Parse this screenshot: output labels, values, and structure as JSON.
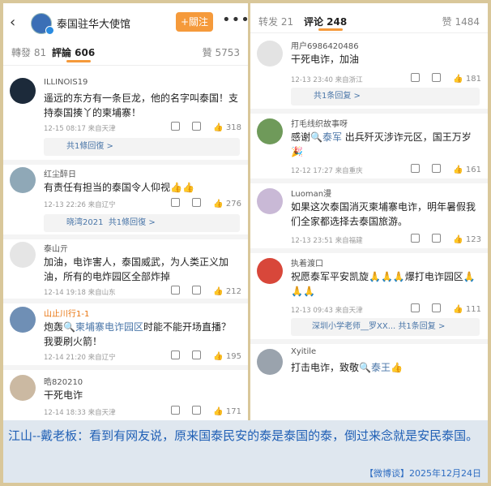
{
  "left": {
    "header": {
      "title": "泰国驻华大使馆",
      "follow": "+關注",
      "more": "•••",
      "back": "‹"
    },
    "tabs": {
      "repost": "轉發 81",
      "comment": "評論 606",
      "like": "贊 5753"
    },
    "comments": [
      {
        "name": "ILLINOIS19",
        "text": "遥远的东方有一条巨龙，他的名字叫泰国！支持泰国揍丫的柬埔寨！",
        "time": "12-15 08:17 来自天津",
        "likes": "318",
        "reply": "共1條回復 >"
      },
      {
        "name": "红尘醉日",
        "text": "有责任有担当的泰国令人仰视👍👍",
        "time": "12-13 22:26 来自辽宁",
        "likes": "276",
        "reply_user": "晓湾2021",
        "reply": "共1條回復 >"
      },
      {
        "name": "泰山亓",
        "text": "加油，电诈害人，泰国威武，为人类正义加油，所有的电炸园区全部炸掉",
        "time": "12-14 19:18 来自山东",
        "likes": "212"
      },
      {
        "name": "山止川行1-1",
        "text_pre": "炮轰",
        "text_link": "柬埔寨电诈园区",
        "text_post": "时能不能开场直播？我要刷火箭！",
        "time": "12-14 21:20 来自辽宁",
        "likes": "195"
      },
      {
        "name": "晧820210",
        "text": "干死电诈",
        "time": "12-14 18:33 来自天津",
        "likes": "171"
      }
    ]
  },
  "right": {
    "tabs": {
      "repost": "转发 21",
      "comment": "评论 248",
      "like": "赞 1484"
    },
    "comments": [
      {
        "name": "用户6986420486",
        "text": "干死电诈，加油",
        "time": "12-13 23:40 来自浙江",
        "likes": "181",
        "reply": "共1条回复 >"
      },
      {
        "name": "打毛线织故事呀",
        "text_pre": "感谢",
        "text_link": "泰军",
        "text_post": " 出兵歼灭涉诈元区，国王万岁🎉",
        "time": "12-12 17:27 来自重庆",
        "likes": "161"
      },
      {
        "name": "Luoman漫",
        "text": "如果这次泰国消灭柬埔寨电诈，明年暑假我们全家都选择去泰国旅游。",
        "time": "12-13 23:51 来自福建",
        "likes": "123"
      },
      {
        "name": "执着渡口",
        "text": "祝愿泰军平安凯旋🙏🙏🙏爆打电诈园区🙏🙏🙏",
        "time": "12-13 09:43 来自天津",
        "likes": "111",
        "reply_user": "深圳小学老师__罗XX...",
        "reply": "共1条回复 >"
      },
      {
        "name": "Ⅹyitile",
        "text_pre": "打击电诈，致敬",
        "text_link": "泰王",
        "text_post": "👍",
        "time": ""
      }
    ]
  },
  "caption": {
    "text": "江山--戴老板：看到有网友说，原来国泰民安的泰是泰国的泰，倒过来念就是安民泰国。",
    "source": "【微博谈】2025年12月24日"
  },
  "colors": {
    "accent": "#f59a3b",
    "link": "#4a76a8",
    "caption": "#1f5fb5",
    "border": "#d9c79a"
  }
}
